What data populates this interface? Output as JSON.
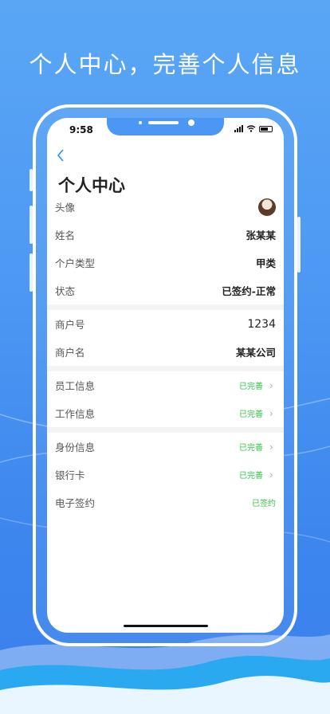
{
  "headline": "个人中心，完善个人信息",
  "status_bar": {
    "time": "9:58"
  },
  "nav": {
    "back_icon": "chevron-left-icon",
    "title": "个人中心"
  },
  "profile": {
    "avatar_label": "头像",
    "name_label": "姓名",
    "name_value": "张某某",
    "type_label": "个户类型",
    "type_value": "甲类",
    "state_label": "状态",
    "state_value": "已签约-正常"
  },
  "merchant": {
    "id_label": "商户号",
    "id_value": "1234",
    "name_label": "商户名",
    "name_value": "某某公司"
  },
  "info": {
    "employee_label": "员工信息",
    "employee_status": "已完善",
    "work_label": "工作信息",
    "work_status": "已完善",
    "identity_label": "身份信息",
    "identity_status": "已完善",
    "bank_label": "银行卡",
    "bank_status": "已完善",
    "esign_label": "电子签约",
    "esign_status": "已签约"
  },
  "colors": {
    "accent": "#2f8cff",
    "success": "#3ac24a",
    "background": "#4d98f3"
  }
}
